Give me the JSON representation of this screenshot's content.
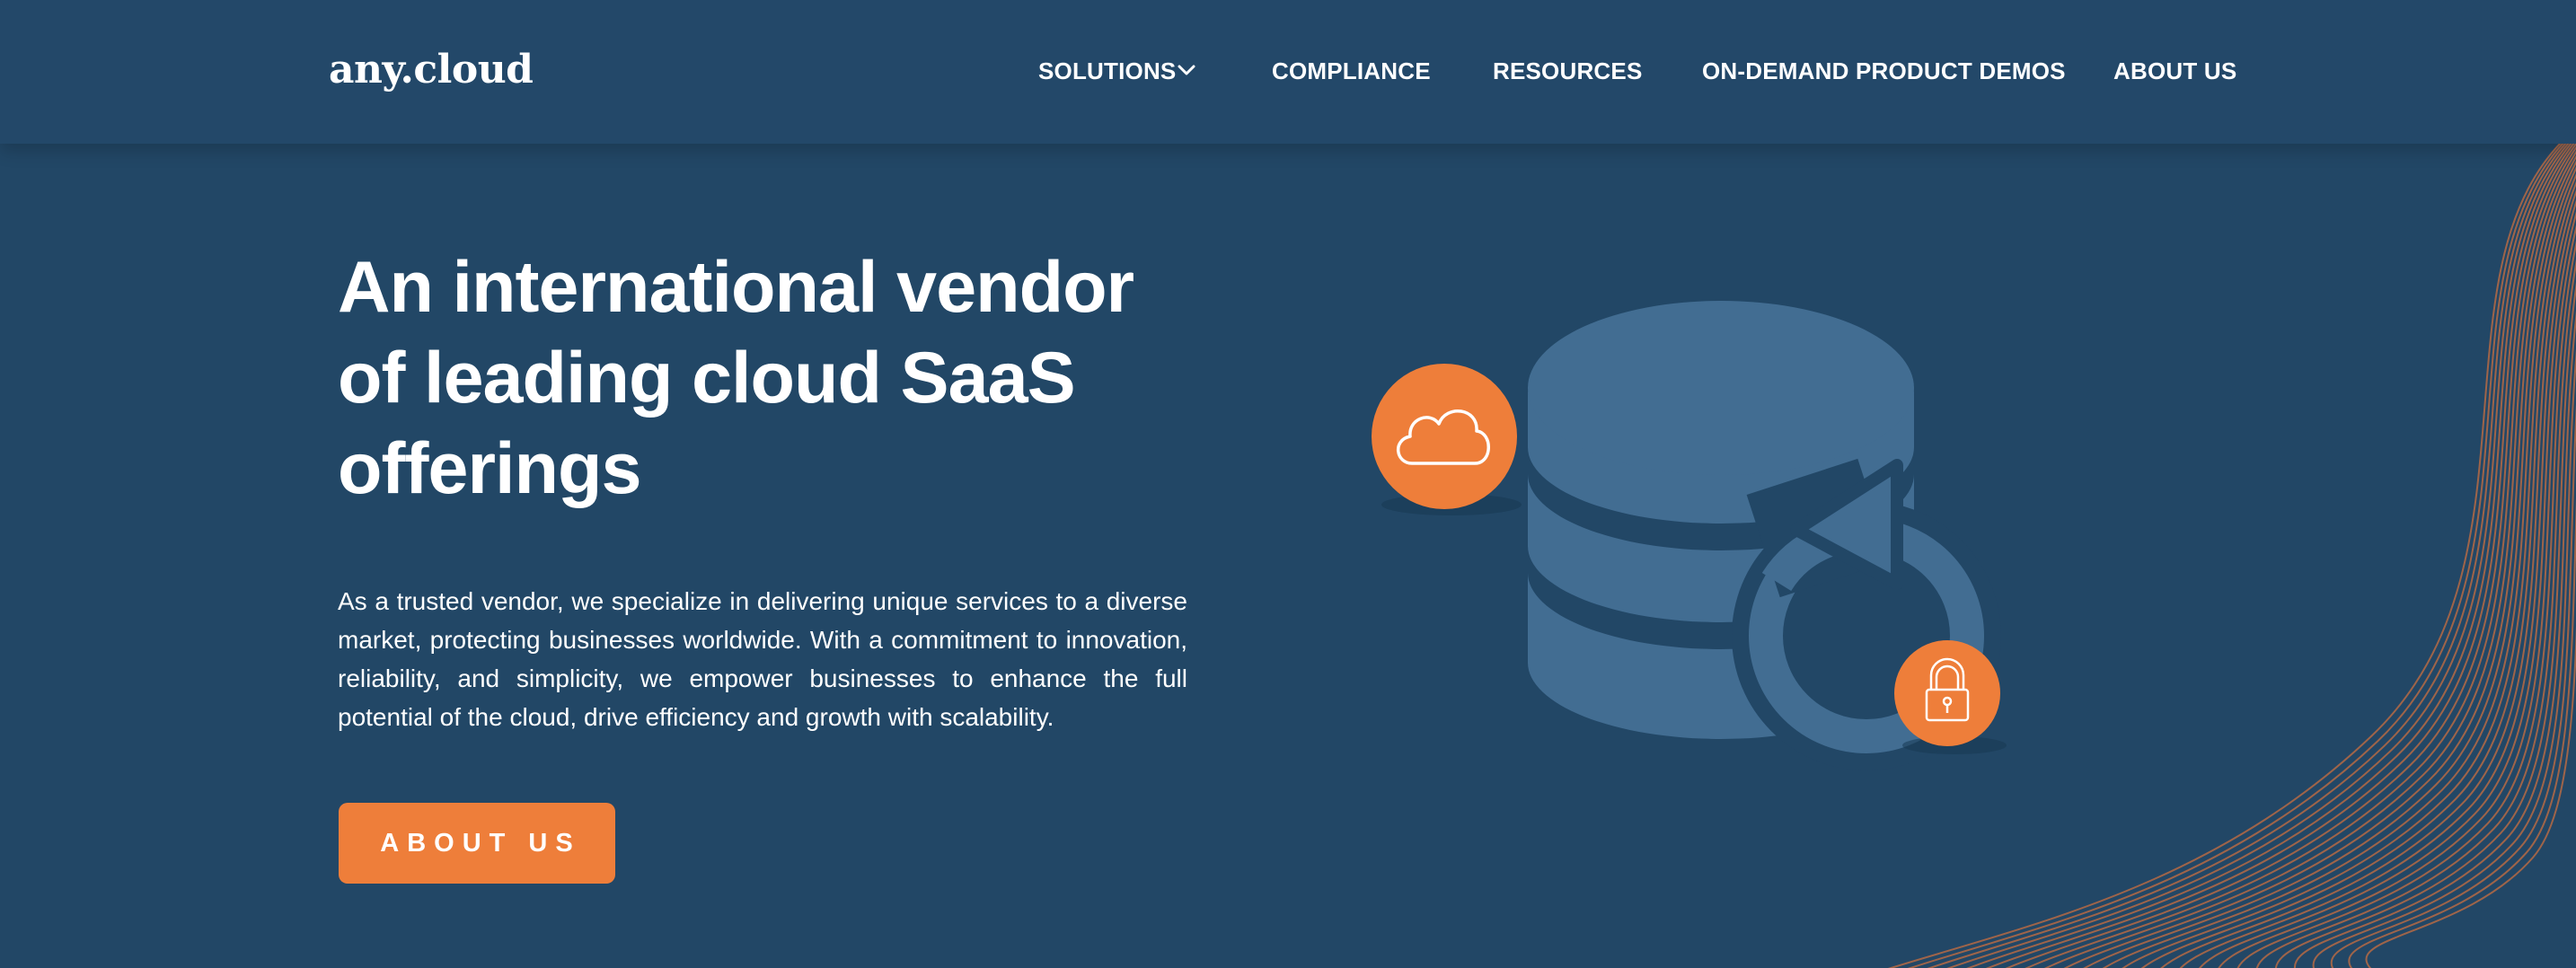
{
  "header": {
    "logo": "any.cloud",
    "nav": [
      {
        "label": "SOLUTIONS",
        "has_dropdown": true
      },
      {
        "label": "COMPLIANCE"
      },
      {
        "label": "RESOURCES"
      },
      {
        "label": "ON-DEMAND PRODUCT DEMOS"
      },
      {
        "label": "ABOUT US"
      }
    ]
  },
  "hero": {
    "title": "An international vendor of leading cloud SaaS offerings",
    "description": "As a trusted vendor, we specialize in delivering unique services to a diverse market, protecting businesses worldwide. With a commitment to innovation, reliability, and simplicity, we empower businesses to enhance the full potential of the cloud, drive efficiency and growth with scalability.",
    "cta_label": "ABOUT US"
  },
  "illustration": {
    "icons": [
      "database-icon",
      "refresh-arrow-icon",
      "cloud-icon",
      "padlock-icon"
    ]
  },
  "colors": {
    "background": "#224766",
    "header": "#234869",
    "accent": "#ee7e3a",
    "illustration": "#426d92",
    "wave_lines": "#b56a44",
    "text": "#ffffff"
  }
}
